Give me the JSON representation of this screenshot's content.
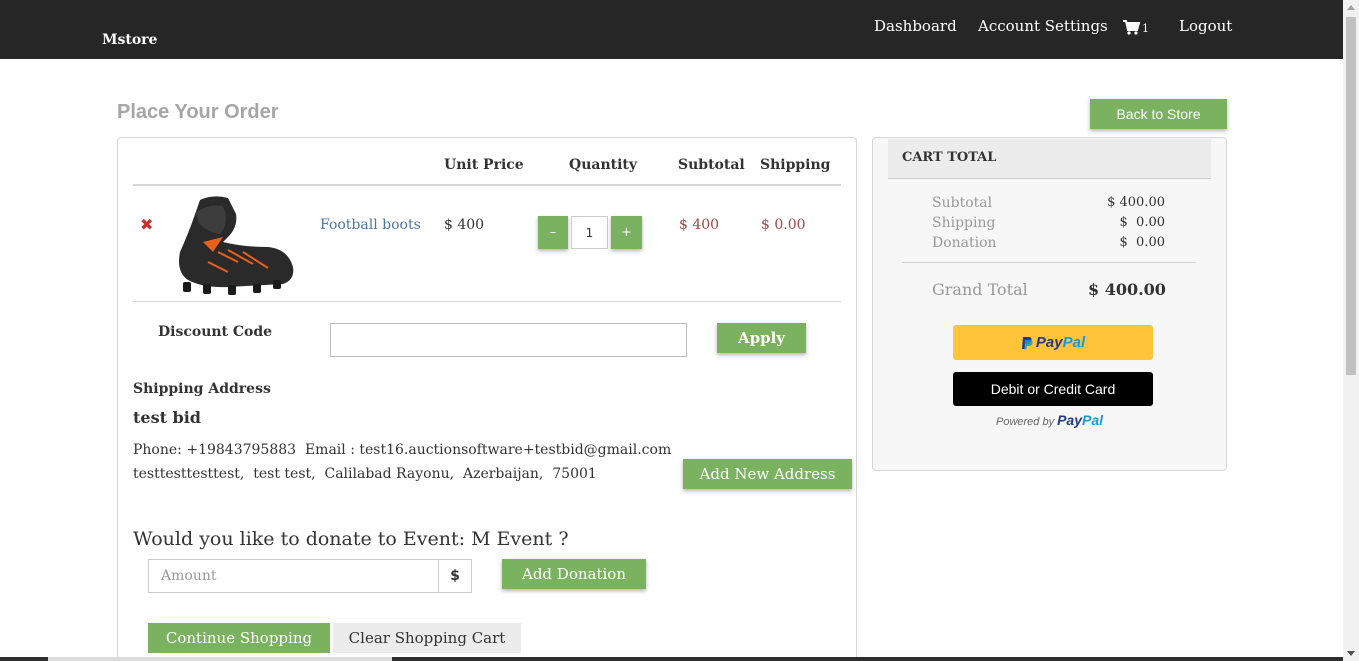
{
  "navbar": {
    "brand": "Mstore",
    "links": {
      "dashboard": "Dashboard",
      "account_settings": "Account Settings",
      "logout": "Logout"
    },
    "cart_count": "1"
  },
  "page": {
    "title": "Place Your Order",
    "back_button": "Back to Store"
  },
  "cart_table": {
    "headers": {
      "unit_price": "Unit Price",
      "quantity": "Quantity",
      "subtotal": "Subtotal",
      "shipping": "Shipping"
    },
    "items": [
      {
        "name": "Football boots",
        "unit_price": "$ 400",
        "quantity": "1",
        "subtotal": "$ 400",
        "shipping": "$ 0.00",
        "remove_icon": "✖",
        "minus_label": "–",
        "plus_label": "+"
      }
    ]
  },
  "discount": {
    "label": "Discount Code",
    "value": "",
    "apply_button": "Apply"
  },
  "shipping_address": {
    "label": "Shipping Address",
    "name": "test bid",
    "phone_line": "Phone: +19843795883  Email : test16.auctionsoftware+testbid@gmail.com",
    "address_line": "testtesttesttest,  test test,  Calilabad Rayonu,  Azerbaijan,  75001",
    "add_button": "Add New Address"
  },
  "donation": {
    "question": "Would you like to donate to Event: M Event ?",
    "amount_placeholder": "Amount",
    "currency_symbol": "$",
    "add_button": "Add Donation"
  },
  "actions": {
    "continue": "Continue Shopping",
    "clear": "Clear Shopping Cart"
  },
  "cart_total": {
    "title": "CART TOTAL",
    "rows": [
      {
        "label": "Subtotal",
        "value": "$ 400.00"
      },
      {
        "label": "Shipping",
        "value": "$  0.00"
      },
      {
        "label": "Donation",
        "value": "$  0.00"
      }
    ],
    "grand_label": "Grand Total",
    "grand_value": "$ 400.00"
  },
  "payment": {
    "paypal_part1": "Pay",
    "paypal_part2": "Pal",
    "card_button": "Debit or Credit Card",
    "powered_by": "Powered by",
    "powered_brand_1": "Pay",
    "powered_brand_2": "Pal"
  },
  "colors": {
    "navbar": "#262626",
    "accent_green": "#7ab260",
    "link_blue": "#4a77a8",
    "price_red": "#a94442",
    "paypal_yellow": "#ffc439"
  },
  "icons": {
    "cart": "cart-icon",
    "remove": "remove-icon",
    "paypal": "paypal-icon"
  }
}
